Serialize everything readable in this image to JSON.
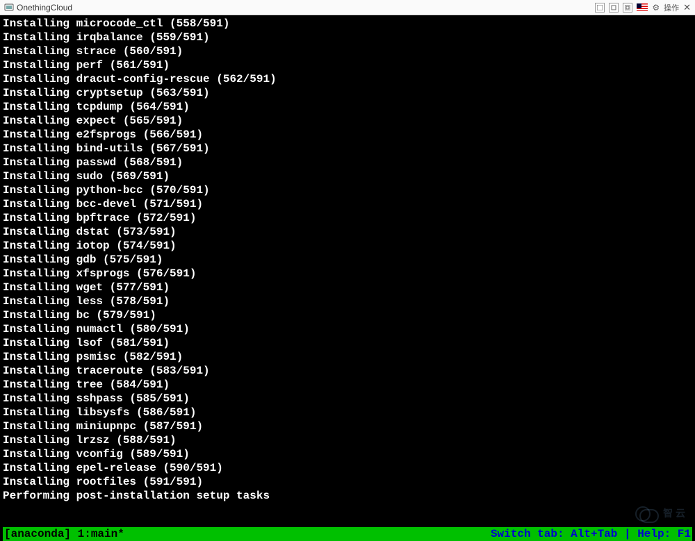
{
  "titlebar": {
    "app_name": "OnethingCloud",
    "ops_label": "操作"
  },
  "terminal": {
    "lines": [
      "Installing microcode_ctl (558/591)",
      "Installing irqbalance (559/591)",
      "Installing strace (560/591)",
      "Installing perf (561/591)",
      "Installing dracut-config-rescue (562/591)",
      "Installing cryptsetup (563/591)",
      "Installing tcpdump (564/591)",
      "Installing expect (565/591)",
      "Installing e2fsprogs (566/591)",
      "Installing bind-utils (567/591)",
      "Installing passwd (568/591)",
      "Installing sudo (569/591)",
      "Installing python-bcc (570/591)",
      "Installing bcc-devel (571/591)",
      "Installing bpftrace (572/591)",
      "Installing dstat (573/591)",
      "Installing iotop (574/591)",
      "Installing gdb (575/591)",
      "Installing xfsprogs (576/591)",
      "Installing wget (577/591)",
      "Installing less (578/591)",
      "Installing bc (579/591)",
      "Installing numactl (580/591)",
      "Installing lsof (581/591)",
      "Installing psmisc (582/591)",
      "Installing traceroute (583/591)",
      "Installing tree (584/591)",
      "Installing sshpass (585/591)",
      "Installing libsysfs (586/591)",
      "Installing miniupnpc (587/591)",
      "Installing lrzsz (588/591)",
      "Installing vconfig (589/591)",
      "Installing epel-release (590/591)",
      "Installing rootfiles (591/591)",
      "Performing post-installation setup tasks"
    ]
  },
  "statusbar": {
    "left": "[anaconda] 1:main*",
    "right": "Switch tab: Alt+Tab | Help: F1"
  },
  "watermark": {
    "text": "智 云"
  }
}
